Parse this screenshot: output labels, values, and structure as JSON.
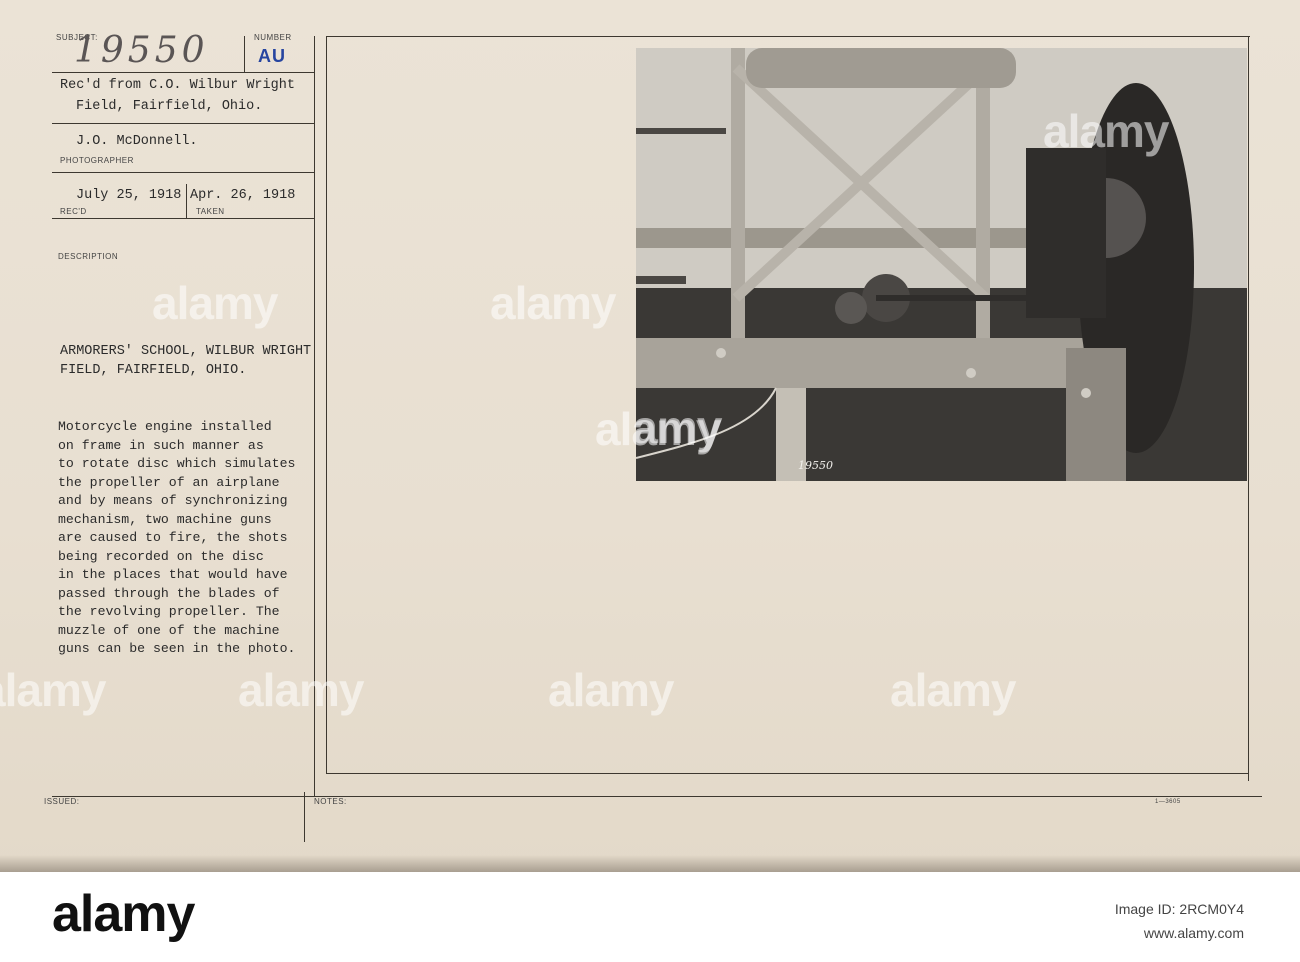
{
  "header": {
    "subject_label": "SUBJECT:",
    "number_label": "NUMBER",
    "subject_number": "19550",
    "number_stamp": "AU"
  },
  "received_from": [
    "Rec'd from C.O. Wilbur Wright",
    "Field, Fairfield, Ohio."
  ],
  "photographer": {
    "name": "J.O. McDonnell.",
    "label": "PHOTOGRAPHER"
  },
  "dates": {
    "received": "July 25, 1918",
    "received_label": "REC'D",
    "taken": "Apr. 26, 1918",
    "taken_label": "TAKEN"
  },
  "description_label": "DESCRIPTION",
  "title": [
    "ARMORERS' SCHOOL, WILBUR WRIGHT",
    "FIELD, FAIRFIELD, OHIO."
  ],
  "description": "Motorcycle engine installed\non frame in such manner as\nto rotate disc which simulates\nthe propeller of an airplane\nand by means of synchronizing\nmechanism, two machine guns\nare caused to fire, the shots\nbeing recorded on the disc\nin the places that would have\npassed through the blades of\nthe revolving propeller. The\nmuzzle of one of the machine\nguns can be seen in the photo.",
  "photo_caption": "19550",
  "issued_label": "ISSUED:",
  "notes_label": "NOTES:",
  "form_code": "1—3605",
  "watermark": "alamy",
  "footer": {
    "logo": "alamy",
    "image_id_label": "Image ID: 2RCM0Y4",
    "site": "www.alamy.com"
  }
}
